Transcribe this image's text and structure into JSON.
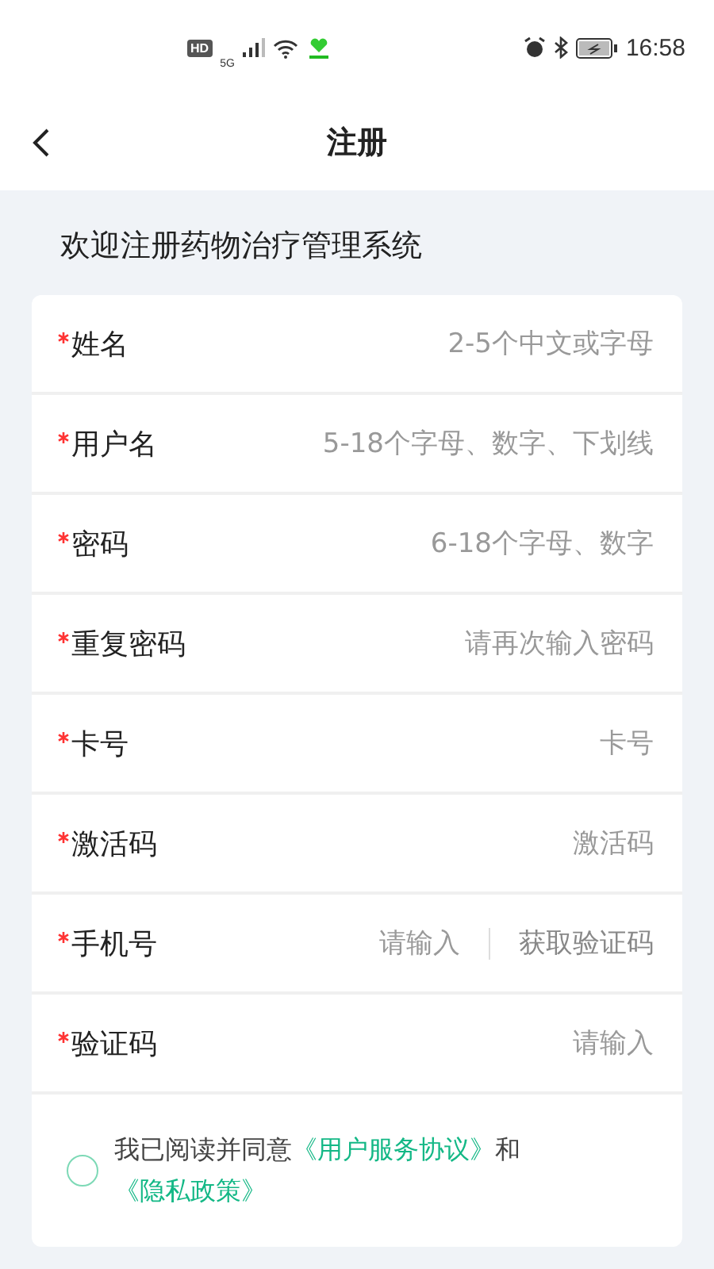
{
  "status_bar": {
    "hd": "HD",
    "network": "5G",
    "time": "16:58"
  },
  "nav": {
    "title": "注册"
  },
  "welcome": "欢迎注册药物治疗管理系统",
  "fields": [
    {
      "kind": "input",
      "label": "姓名",
      "required": true,
      "placeholder": "2-5个中文或字母"
    },
    {
      "kind": "input",
      "label": "用户名",
      "required": true,
      "placeholder": "5-18个字母、数字、下划线"
    },
    {
      "kind": "input",
      "label": "密码",
      "required": true,
      "placeholder": "6-18个字母、数字"
    },
    {
      "kind": "input",
      "label": "重复密码",
      "required": true,
      "placeholder": "请再次输入密码"
    },
    {
      "kind": "input",
      "label": "卡号",
      "required": true,
      "placeholder": "卡号"
    },
    {
      "kind": "input",
      "label": "激活码",
      "required": true,
      "placeholder": "激活码"
    },
    {
      "kind": "sms",
      "label": "手机号",
      "required": true,
      "placeholder": "请输入",
      "action": "获取验证码"
    },
    {
      "kind": "input",
      "label": "验证码",
      "required": true,
      "placeholder": "请输入"
    }
  ],
  "agreement": {
    "checked": false,
    "text": "我已阅读并同意",
    "link1": "《用户服务协议》",
    "joiner": "和",
    "link2": "《隐私政策》"
  }
}
